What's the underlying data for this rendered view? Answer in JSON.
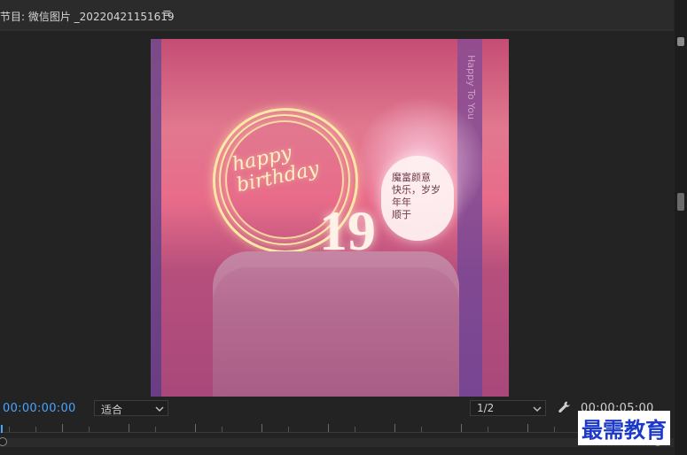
{
  "panel": {
    "title": "节目: 微信图片 _20220421151619",
    "menu_icon": "hamburger-icon"
  },
  "viewer": {
    "image": {
      "ring_text": "happy birthday",
      "number": "19",
      "card_lines": [
        "魔富颜意",
        "快乐，岁岁年年",
        "顺于"
      ],
      "side_text": "Happy To You"
    }
  },
  "controls": {
    "current_timecode": "00:00:00:00",
    "fit_label": "适合",
    "resolution_label": "1/2",
    "duration_timecode": "00:00:05:00",
    "wrench_icon": "wrench-icon"
  },
  "colors": {
    "accent": "#4aa3ff",
    "background": "#232323",
    "watermark": "#1d39c8"
  },
  "watermark": {
    "text": "最需教育"
  }
}
